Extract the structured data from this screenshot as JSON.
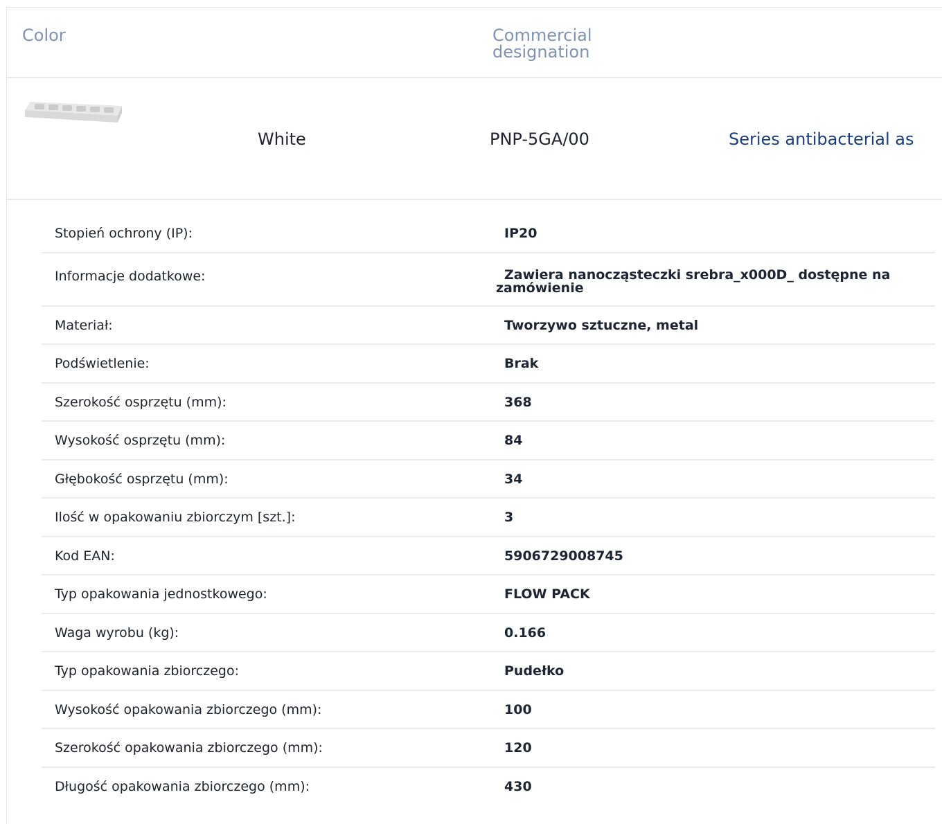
{
  "header": {
    "color_label": "Color",
    "designation_label": "Commercial designation"
  },
  "product": {
    "image_name": "product-thumbnail",
    "color": "White",
    "code": "PNP-5GA/00",
    "series_link": "Series antibacterial as"
  },
  "specs": [
    {
      "label": "Stopień ochrony (IP):",
      "value": "IP20"
    },
    {
      "label": "Informacje dodatkowe:",
      "value": "Zawiera nanocząsteczki srebra_x000D_ dostępne na zamówienie"
    },
    {
      "label": "Materiał:",
      "value": "Tworzywo sztuczne, metal"
    },
    {
      "label": "Podświetlenie:",
      "value": "Brak"
    },
    {
      "label": "Szerokość osprzętu (mm):",
      "value": "368"
    },
    {
      "label": "Wysokość osprzętu (mm):",
      "value": "84"
    },
    {
      "label": "Głębokość osprzętu (mm):",
      "value": "34"
    },
    {
      "label": "Ilość w opakowaniu zbiorczym [szt.]:",
      "value": "3"
    },
    {
      "label": "Kod EAN:",
      "value": "5906729008745"
    },
    {
      "label": "Typ opakowania jednostkowego:",
      "value": "FLOW PACK"
    },
    {
      "label": "Waga wyrobu (kg):",
      "value": "0.166"
    },
    {
      "label": "Typ opakowania zbiorczego:",
      "value": "Pudełko"
    },
    {
      "label": "Wysokość opakowania zbiorczego (mm):",
      "value": "100"
    },
    {
      "label": "Szerokość opakowania zbiorczego (mm):",
      "value": "120"
    },
    {
      "label": "Długość opakowania zbiorczego (mm):",
      "value": "430"
    }
  ]
}
